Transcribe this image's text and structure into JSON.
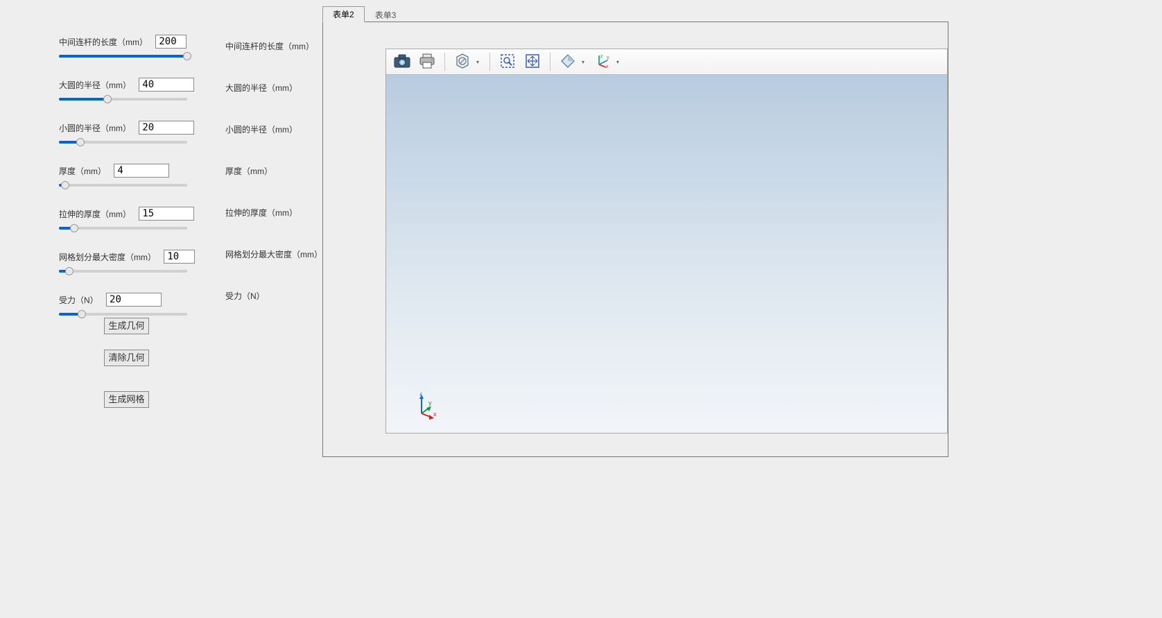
{
  "params": [
    {
      "label": "中间连杆的长度（mm）",
      "value": "200",
      "fillPct": 100,
      "thumbPct": 100,
      "inputWidth": "narrow"
    },
    {
      "label": "大圆的半径（mm）",
      "value": "40",
      "fillPct": 38,
      "thumbPct": 38,
      "inputWidth": "wide"
    },
    {
      "label": "小圆的半径（mm）",
      "value": "20",
      "fillPct": 17,
      "thumbPct": 17,
      "inputWidth": "wide"
    },
    {
      "label": "厚度（mm）",
      "value": "4",
      "fillPct": 5,
      "thumbPct": 5,
      "inputWidth": "wide"
    },
    {
      "label": "拉伸的厚度（mm）",
      "value": "15",
      "fillPct": 12,
      "thumbPct": 12,
      "inputWidth": "wide"
    },
    {
      "label": "网格划分最大密度（mm）",
      "value": "10",
      "fillPct": 8,
      "thumbPct": 8,
      "inputWidth": "narrow"
    },
    {
      "label": "受力（N）",
      "value": "20",
      "fillPct": 18,
      "thumbPct": 18,
      "inputWidth": "wide"
    }
  ],
  "rightLabels": [
    "中间连杆的长度（mm）",
    "大圆的半径（mm）",
    "小圆的半径（mm）",
    "厚度（mm）",
    "拉伸的厚度（mm）",
    "网格划分最大密度（mm）",
    "受力（N）"
  ],
  "buttons": {
    "generateGeometry": "生成几何",
    "clearGeometry": "清除几何",
    "generateMesh": "生成网格"
  },
  "tabs": {
    "tab2": "表单2",
    "tab3": "表单3",
    "active": "tab2"
  },
  "toolbar": {
    "screenshot": "screenshot",
    "print": "print",
    "sceneLight": "scene-light",
    "zoomBox": "zoom-box",
    "zoomExtents": "zoom-extents",
    "transparency": "transparency",
    "axisOrientation": "axis-orientation"
  },
  "axis": {
    "x": "x",
    "y": "y",
    "z": "z"
  }
}
